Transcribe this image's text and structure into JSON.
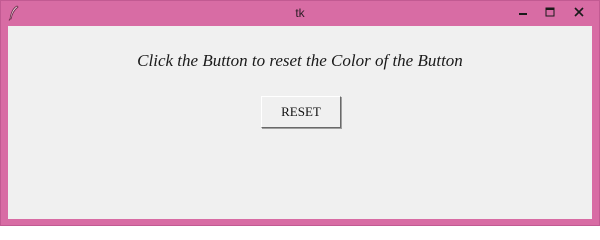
{
  "window": {
    "title": "tk",
    "border_color": "#d86ca4",
    "icons": {
      "app": "tk-feather-icon",
      "minimize": "minimize-icon",
      "maximize": "maximize-icon",
      "close": "close-icon"
    }
  },
  "main": {
    "message": "Click the Button to reset the Color of the Button",
    "reset_button_label": "RESET",
    "background": "#f0f0f0"
  }
}
